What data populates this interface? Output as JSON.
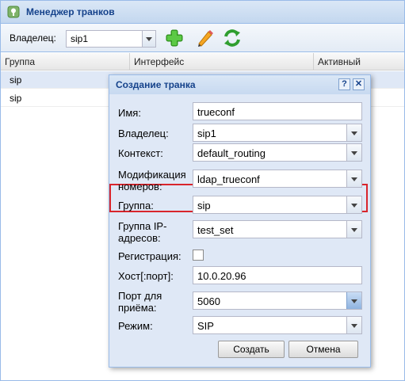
{
  "window": {
    "title": "Менеджер транков"
  },
  "toolbar": {
    "owner_label": "Владелец:",
    "owner_value": "sip1",
    "icons": [
      "add-icon",
      "edit-icon",
      "refresh-icon"
    ]
  },
  "grid": {
    "columns": [
      "Группа",
      "Интерфейс",
      "Активный"
    ],
    "rows": [
      [
        "sip"
      ],
      [
        "sip"
      ]
    ]
  },
  "dialog": {
    "title": "Создание транка",
    "fields": {
      "name": {
        "label": "Имя:",
        "value": "trueconf"
      },
      "owner": {
        "label": "Владелец:",
        "value": "sip1"
      },
      "context": {
        "label": "Контекст:",
        "value": "default_routing"
      },
      "modification_line1": "Модификация",
      "modification_line2": "номеров:",
      "modification": {
        "value": "ldap_trueconf"
      },
      "group": {
        "label": "Группа:",
        "value": "sip"
      },
      "ip_group_line1": "Группа IP-",
      "ip_group_line2": "адресов:",
      "ip_group": {
        "value": "test_set"
      },
      "registration": {
        "label": "Регистрация:",
        "checked": false
      },
      "host": {
        "label": "Хост[:порт]:",
        "value": "10.0.20.96"
      },
      "port_line1": "Порт для",
      "port_line2": "приёма:",
      "port": {
        "value": "5060"
      },
      "mode": {
        "label": "Режим:",
        "value": "SIP"
      }
    },
    "create_label": "Создать",
    "cancel_label": "Отмена",
    "help_glyph": "?",
    "close_glyph": "✕"
  },
  "colors": {
    "accent": "#15428b",
    "highlight": "#d9252c",
    "header": "#c3d7ef"
  }
}
